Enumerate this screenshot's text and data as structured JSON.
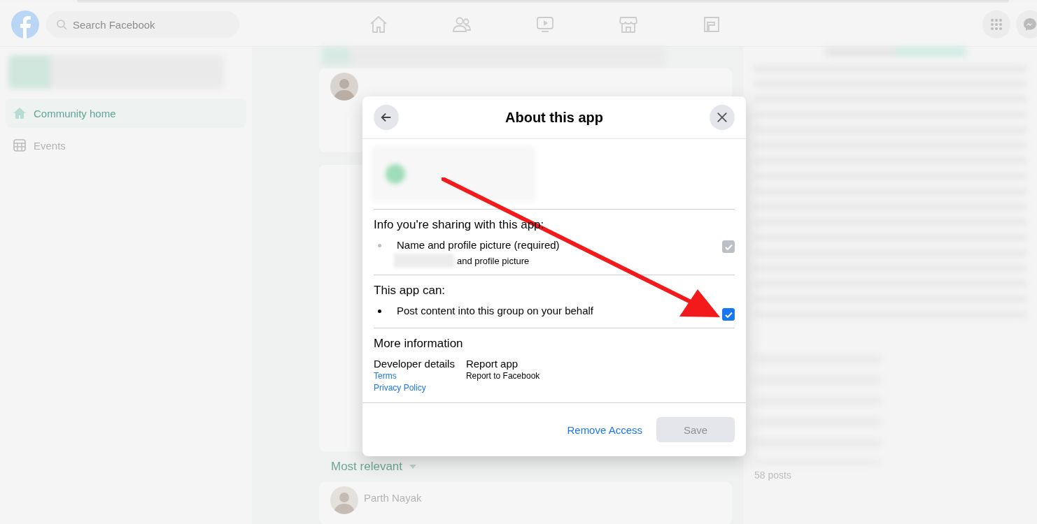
{
  "top_bar": {
    "search": {
      "placeholder": "Search Facebook"
    }
  },
  "sidebar": {
    "items": [
      {
        "label": "Community home",
        "selected": true,
        "kind": "home"
      },
      {
        "label": "Events",
        "selected": false,
        "kind": "calendar"
      }
    ]
  },
  "feed": {
    "sort": "Most relevant",
    "comment_author": "Parth Nayak"
  },
  "right_panel": {
    "topic_count": "58 posts"
  },
  "dialog": {
    "title": "About this app",
    "sections": [
      {
        "heading": "Info you're sharing with this app:",
        "items": [
          {
            "label": "Name and profile picture (required)",
            "detail": "and profile picture",
            "checked": true,
            "disabled": true
          }
        ]
      },
      {
        "heading": "This app can:",
        "items": [
          {
            "label": "Post content into this group on your behalf",
            "checked": true,
            "disabled": false
          }
        ]
      }
    ],
    "more_info": {
      "heading": "More information",
      "columns": [
        {
          "title": "Developer details",
          "lines": [
            {
              "text": "Terms",
              "kind": "link"
            },
            {
              "text": "Privacy Policy",
              "kind": "link"
            }
          ]
        },
        {
          "title": "Report app",
          "lines": [
            {
              "text": "Report to Facebook",
              "kind": "plain"
            }
          ]
        }
      ]
    },
    "buttons": [
      {
        "label": "Remove Access",
        "kind": "link",
        "disabled": false
      },
      {
        "label": "Save",
        "kind": "primary",
        "disabled": true
      }
    ]
  }
}
